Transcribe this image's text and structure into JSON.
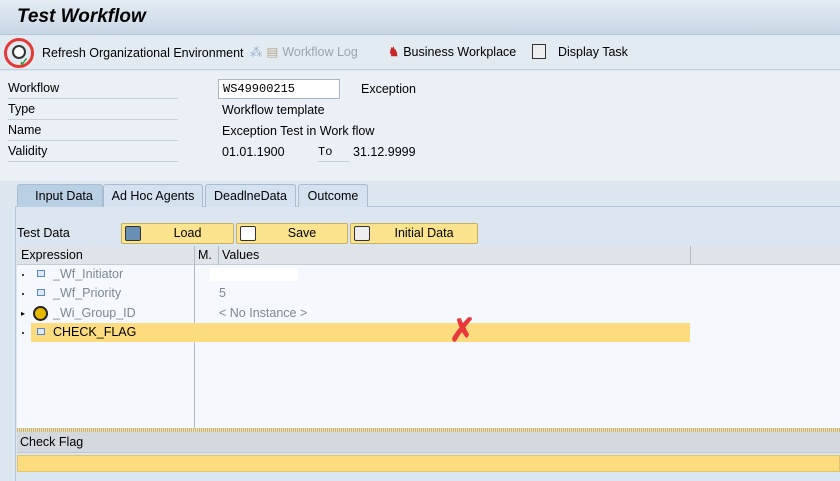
{
  "title": "Test Workflow",
  "toolbar": {
    "refresh": "Refresh Organizational Environment",
    "log": "Workflow Log",
    "workplace": "Business Workplace",
    "display": "Display Task"
  },
  "form": {
    "workflow_label": "Workflow",
    "workflow_value": "WS49900215",
    "workflow_desc": "Exception",
    "type_label": "Type",
    "type_value": "Workflow template",
    "name_label": "Name",
    "name_value": "Exception Test in Work flow",
    "validity_label": "Validity",
    "valid_from": "01.01.1900",
    "to_label": "To",
    "valid_to": "31.12.9999"
  },
  "tabs": [
    "Input Data",
    "Ad Hoc Agents",
    "DeadlneData",
    "Outcome"
  ],
  "testdata": {
    "label": "Test Data",
    "load": "Load",
    "save": "Save",
    "initial": "Initial Data"
  },
  "table": {
    "headers": [
      "Expression",
      "M.",
      "Values"
    ],
    "rows": [
      {
        "expr": "_Wf_Initiator",
        "value": ""
      },
      {
        "expr": "_Wf_Priority",
        "value": "5"
      },
      {
        "expr": "_Wi_Group_ID",
        "value": "< No Instance >"
      },
      {
        "expr": "CHECK_FLAG",
        "value": ""
      }
    ]
  },
  "detail": {
    "label": "Check Flag"
  },
  "colors": {
    "highlight": "#fddc7f",
    "annotation": "#e8383d"
  }
}
